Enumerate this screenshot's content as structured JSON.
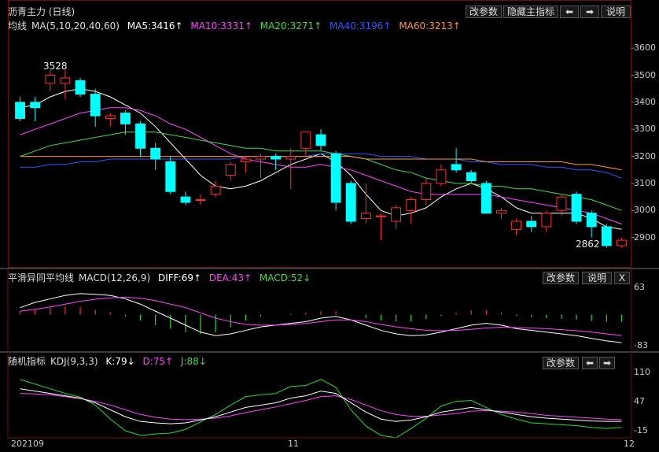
{
  "title": "沥青主力 (日线)",
  "top_buttons": {
    "params": "改参数",
    "hide": "隐藏主指标",
    "left": "⬅",
    "right": "➡",
    "help": "说明"
  },
  "main": {
    "label": "均线",
    "ma_text": "MA(5,10,20,40,60)",
    "ma5": "MA5:3416↑",
    "ma10": "MA10:3331↑",
    "ma20": "MA20:3271↑",
    "ma40": "MA40:3196↑",
    "ma60": "MA60:3213↑",
    "high_label": "3528",
    "low_label": "2862",
    "yticks": [
      "3600",
      "3500",
      "3400",
      "3300",
      "3200",
      "3100",
      "3000",
      "2900"
    ]
  },
  "macd": {
    "label": "平滑异同平均线",
    "params": "MACD(12,26,9)",
    "diff": "DIFF:69↑",
    "dea": "DEA:43↑",
    "macd": "MACD:52↓",
    "btn_params": "改参数",
    "btn_help": "说明",
    "btn_close": "X",
    "yticks": [
      "63",
      "-83"
    ]
  },
  "kdj": {
    "label": "随机指标",
    "params": "KDJ(9,3,3)",
    "k": "K:79↓",
    "d": "D:75↑",
    "j": "J:88↓",
    "btn_params": "改参数",
    "btn_left": "⬅",
    "btn_right": "➡",
    "yticks": [
      "110",
      "47",
      "-15"
    ]
  },
  "xaxis": [
    "202109",
    "11",
    "12"
  ],
  "colors": {
    "up": "#ff3030",
    "down": "#00ffff",
    "ma5": "#ffffff",
    "ma10": "#ff44ff",
    "ma20": "#44dd44",
    "ma40": "#3355ff",
    "ma60": "#ff9933"
  },
  "chart_data": {
    "type": "candlestick",
    "ylim": [
      2800,
      3650
    ],
    "candles": [
      {
        "o": 3400,
        "h": 3420,
        "l": 3330,
        "c": 3340
      },
      {
        "o": 3400,
        "h": 3420,
        "l": 3330,
        "c": 3380
      },
      {
        "o": 3470,
        "h": 3520,
        "l": 3440,
        "c": 3500
      },
      {
        "o": 3470,
        "h": 3520,
        "l": 3410,
        "c": 3490
      },
      {
        "o": 3480,
        "h": 3490,
        "l": 3420,
        "c": 3430
      },
      {
        "o": 3430,
        "h": 3450,
        "l": 3310,
        "c": 3350
      },
      {
        "o": 3340,
        "h": 3360,
        "l": 3310,
        "c": 3350
      },
      {
        "o": 3360,
        "h": 3370,
        "l": 3280,
        "c": 3320
      },
      {
        "o": 3320,
        "h": 3330,
        "l": 3200,
        "c": 3230
      },
      {
        "o": 3230,
        "h": 3250,
        "l": 3150,
        "c": 3190
      },
      {
        "o": 3180,
        "h": 3200,
        "l": 3060,
        "c": 3070
      },
      {
        "o": 3050,
        "h": 3070,
        "l": 3020,
        "c": 3030
      },
      {
        "o": 3040,
        "h": 3060,
        "l": 3020,
        "c": 3040
      },
      {
        "o": 3060,
        "h": 3110,
        "l": 3050,
        "c": 3090
      },
      {
        "o": 3130,
        "h": 3180,
        "l": 3110,
        "c": 3170
      },
      {
        "o": 3180,
        "h": 3200,
        "l": 3140,
        "c": 3190
      },
      {
        "o": 3190,
        "h": 3210,
        "l": 3120,
        "c": 3200
      },
      {
        "o": 3200,
        "h": 3210,
        "l": 3150,
        "c": 3190
      },
      {
        "o": 3190,
        "h": 3230,
        "l": 3080,
        "c": 3200
      },
      {
        "o": 3230,
        "h": 3290,
        "l": 3200,
        "c": 3290
      },
      {
        "o": 3280,
        "h": 3300,
        "l": 3220,
        "c": 3240
      },
      {
        "o": 3210,
        "h": 3220,
        "l": 3000,
        "c": 3030
      },
      {
        "o": 3100,
        "h": 3110,
        "l": 2950,
        "c": 2960
      },
      {
        "o": 2970,
        "h": 3100,
        "l": 2950,
        "c": 2990
      },
      {
        "o": 2980,
        "h": 2990,
        "l": 2890,
        "c": 2980
      },
      {
        "o": 2960,
        "h": 3020,
        "l": 2930,
        "c": 3010
      },
      {
        "o": 3000,
        "h": 3050,
        "l": 2950,
        "c": 3040
      },
      {
        "o": 3040,
        "h": 3120,
        "l": 3020,
        "c": 3100
      },
      {
        "o": 3100,
        "h": 3170,
        "l": 3090,
        "c": 3150
      },
      {
        "o": 3170,
        "h": 3230,
        "l": 3140,
        "c": 3150
      },
      {
        "o": 3140,
        "h": 3150,
        "l": 3100,
        "c": 3110
      },
      {
        "o": 3100,
        "h": 3110,
        "l": 2990,
        "c": 2990
      },
      {
        "o": 2990,
        "h": 3010,
        "l": 2970,
        "c": 3000
      },
      {
        "o": 2930,
        "h": 2970,
        "l": 2910,
        "c": 2960
      },
      {
        "o": 2960,
        "h": 2980,
        "l": 2920,
        "c": 2940
      },
      {
        "o": 2940,
        "h": 3000,
        "l": 2920,
        "c": 2990
      },
      {
        "o": 3000,
        "h": 3060,
        "l": 2980,
        "c": 3050
      },
      {
        "o": 3060,
        "h": 3070,
        "l": 2950,
        "c": 2960
      },
      {
        "o": 2990,
        "h": 3000,
        "l": 2900,
        "c": 2940
      },
      {
        "o": 2940,
        "h": 2950,
        "l": 2862,
        "c": 2870
      },
      {
        "o": 2870,
        "h": 2900,
        "l": 2862,
        "c": 2890
      }
    ],
    "ma_series": [
      {
        "name": "MA5",
        "values": [
          3380,
          3390,
          3420,
          3440,
          3450,
          3440,
          3420,
          3390,
          3360,
          3310,
          3250,
          3190,
          3130,
          3090,
          3080,
          3090,
          3110,
          3140,
          3170,
          3190,
          3210,
          3180,
          3130,
          3060,
          3000,
          2980,
          2990,
          3010,
          3050,
          3080,
          3100,
          3080,
          3050,
          3010,
          2990,
          2990,
          2990,
          2990,
          2970,
          2940,
          2930
        ]
      },
      {
        "name": "MA10",
        "values": [
          3280,
          3300,
          3320,
          3340,
          3360,
          3370,
          3380,
          3380,
          3370,
          3350,
          3320,
          3300,
          3270,
          3240,
          3210,
          3190,
          3180,
          3170,
          3160,
          3160,
          3170,
          3160,
          3150,
          3130,
          3110,
          3090,
          3070,
          3060,
          3060,
          3060,
          3060,
          3060,
          3050,
          3040,
          3030,
          3020,
          3010,
          3000,
          2990,
          2970,
          2950
        ]
      },
      {
        "name": "MA20",
        "values": [
          3200,
          3220,
          3240,
          3250,
          3260,
          3270,
          3280,
          3290,
          3290,
          3290,
          3280,
          3270,
          3260,
          3250,
          3240,
          3230,
          3230,
          3220,
          3220,
          3220,
          3220,
          3210,
          3200,
          3190,
          3170,
          3150,
          3140,
          3120,
          3110,
          3100,
          3100,
          3090,
          3090,
          3080,
          3080,
          3070,
          3060,
          3050,
          3040,
          3020,
          3000
        ]
      },
      {
        "name": "MA40",
        "values": [
          3160,
          3160,
          3170,
          3170,
          3180,
          3180,
          3190,
          3190,
          3190,
          3190,
          3190,
          3190,
          3190,
          3190,
          3190,
          3200,
          3200,
          3200,
          3200,
          3200,
          3210,
          3210,
          3210,
          3210,
          3200,
          3200,
          3200,
          3190,
          3190,
          3190,
          3180,
          3180,
          3170,
          3170,
          3170,
          3160,
          3160,
          3150,
          3150,
          3140,
          3120
        ]
      },
      {
        "name": "MA60",
        "values": [
          3200,
          3200,
          3200,
          3200,
          3200,
          3200,
          3200,
          3200,
          3200,
          3200,
          3200,
          3200,
          3200,
          3200,
          3200,
          3200,
          3200,
          3200,
          3200,
          3200,
          3200,
          3200,
          3200,
          3190,
          3190,
          3190,
          3190,
          3190,
          3190,
          3190,
          3190,
          3180,
          3180,
          3180,
          3180,
          3180,
          3180,
          3170,
          3170,
          3160,
          3150
        ]
      }
    ],
    "macd": {
      "ylim": [
        -100,
        80
      ],
      "diff": [
        20,
        35,
        45,
        55,
        60,
        58,
        55,
        45,
        30,
        10,
        -10,
        -30,
        -50,
        -60,
        -55,
        -45,
        -35,
        -30,
        -25,
        -20,
        -10,
        -5,
        -15,
        -30,
        -45,
        -55,
        -60,
        -58,
        -50,
        -40,
        -30,
        -25,
        -30,
        -40,
        -45,
        -50,
        -55,
        -60,
        -68,
        -75,
        -80
      ],
      "dea": [
        10,
        15,
        22,
        30,
        38,
        44,
        48,
        50,
        47,
        40,
        30,
        20,
        5,
        -10,
        -20,
        -28,
        -30,
        -30,
        -28,
        -25,
        -20,
        -15,
        -15,
        -20,
        -28,
        -35,
        -40,
        -45,
        -46,
        -45,
        -42,
        -38,
        -36,
        -37,
        -38,
        -40,
        -43,
        -46,
        -50,
        -55,
        -60
      ],
      "hist": [
        20,
        30,
        40,
        45,
        44,
        28,
        14,
        -10,
        -34,
        -60,
        -80,
        -100,
        -110,
        -100,
        -70,
        -34,
        -10,
        0,
        6,
        10,
        20,
        20,
        0,
        -20,
        -34,
        -40,
        -40,
        -26,
        -8,
        10,
        24,
        26,
        12,
        -6,
        -14,
        -20,
        -24,
        -28,
        -36,
        -40,
        -40
      ]
    },
    "kdj": {
      "ylim": [
        -20,
        115
      ],
      "k": [
        75,
        70,
        65,
        60,
        55,
        45,
        30,
        15,
        5,
        2,
        0,
        2,
        8,
        15,
        25,
        35,
        40,
        45,
        55,
        60,
        70,
        65,
        45,
        25,
        10,
        5,
        8,
        15,
        25,
        30,
        35,
        30,
        25,
        20,
        15,
        12,
        10,
        8,
        6,
        5,
        5
      ],
      "d": [
        65,
        64,
        62,
        58,
        54,
        48,
        40,
        30,
        20,
        14,
        10,
        9,
        10,
        12,
        17,
        24,
        30,
        36,
        43,
        50,
        58,
        60,
        52,
        40,
        28,
        20,
        16,
        16,
        19,
        22,
        27,
        28,
        27,
        25,
        22,
        18,
        16,
        14,
        12,
        10,
        9
      ],
      "j": [
        95,
        85,
        75,
        65,
        57,
        40,
        10,
        -15,
        -25,
        -22,
        -20,
        -12,
        4,
        20,
        40,
        58,
        62,
        65,
        80,
        82,
        95,
        78,
        30,
        -5,
        -25,
        -30,
        -10,
        12,
        38,
        48,
        50,
        35,
        20,
        10,
        2,
        0,
        -2,
        -4,
        -8,
        -10,
        -8
      ]
    }
  }
}
